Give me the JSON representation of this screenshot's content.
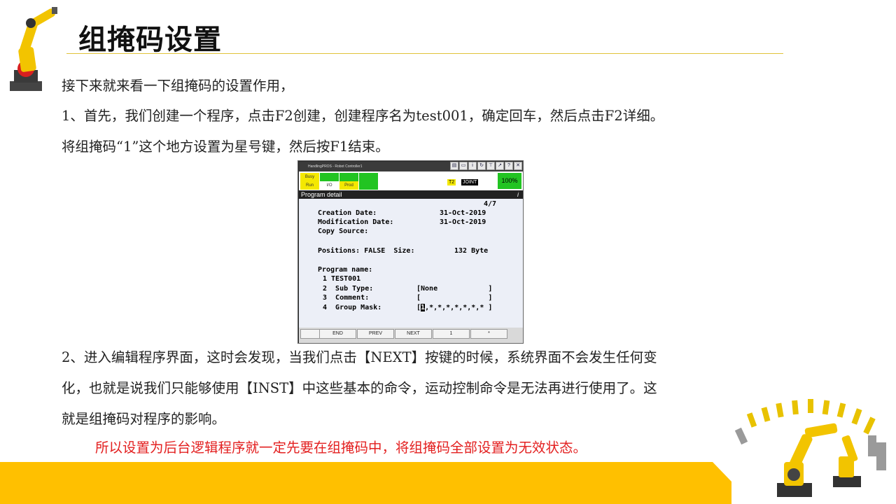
{
  "title": "组掩码设置",
  "paragraphs": {
    "p1": "接下来就来看一下组掩码的设置作用，",
    "p2": "1、首先，我们创建一个程序，点击F2创建，创建程序名为test001，确定回车，然后点击F2详细。",
    "p3": "将组掩码“1”这个地方设置为星号键，然后按F1结束。",
    "p4": "2、进入编辑程序界面，这时会发现，当我们点击【NEXT】按键的时候，系统界面不会发生任何变",
    "p5": "化，也就是说我们只能够使用【INST】中这些基本的命令，运动控制命令是无法再进行使用了。这",
    "p6": "就是组掩码对程序的影响。",
    "note": "所以设置为后台逻辑程序就一定先要在组掩码中，将组掩码全部设置为无效状态。"
  },
  "pendant": {
    "window_title": "HandlingPROS - Robot Controller1",
    "status": {
      "busy": "Busy",
      "run": "Run",
      "io": "I/O",
      "prod": "Prod",
      "mode": "T2",
      "coord": "JOINT",
      "override": "100%"
    },
    "screen_title": "Program detail",
    "info_glyph": "i",
    "page_indicator": "4/7",
    "creation_label": "Creation Date:",
    "creation_value": "31-Oct-2019",
    "modification_label": "Modification Date:",
    "modification_value": "31-Oct-2019",
    "copy_source_label": "Copy Source:",
    "positions_line": "Positions: FALSE  Size:",
    "size_value": "132 Byte",
    "program_name_label": "Program name:",
    "line1": "1 TEST001",
    "line2_label": "2  Sub Type:",
    "line2_value": "[None            ]",
    "line3_label": "3  Comment:",
    "line3_value": "[                ]",
    "line4_label": "4  Group Mask:",
    "mask_open": "[",
    "mask_cursor": "1",
    "mask_rest": ",*,*,*,*,*,*,* ]",
    "fkeys": [
      "END",
      "PREV",
      "NEXT",
      "1",
      "*"
    ]
  },
  "colors": {
    "accent_yellow": "#ffc000",
    "note_red": "#e32020",
    "title_rule": "#e0c23a"
  }
}
